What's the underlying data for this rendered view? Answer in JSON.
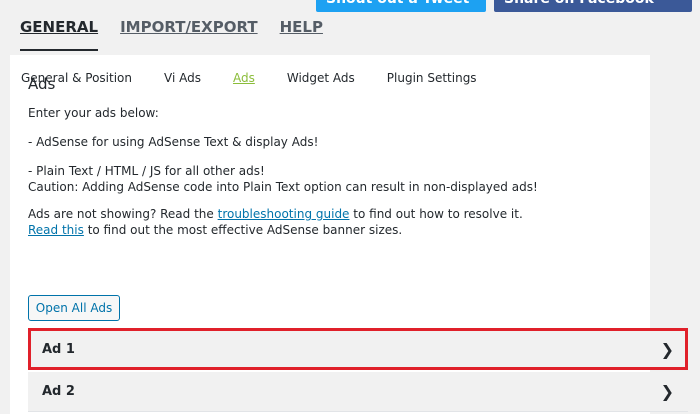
{
  "top_buttons": {
    "tweet": "Shout out a Tweet",
    "facebook": "Share on Facebook"
  },
  "main_tabs": [
    "GENERAL",
    "IMPORT/EXPORT",
    "HELP"
  ],
  "sub_tabs": [
    "General & Position",
    "Vi Ads",
    "Ads",
    "Widget Ads",
    "Plugin Settings"
  ],
  "ads": {
    "title": "Ads",
    "enter_text": "Enter your ads below:",
    "adsense_line": "- AdSense for using AdSense Text & display Ads!",
    "plain_line": "- Plain Text / HTML / JS for all other ads!",
    "caution_line": "Caution: Adding AdSense code into Plain Text option can result in non-displayed ads!",
    "not_showing_prefix": "Ads are not showing? Read the ",
    "troubleshooting_link": "troubleshooting guide",
    "not_showing_suffix": " to find out how to resolve it.",
    "read_this_link": "Read this",
    "read_this_suffix": " to find out the most effective AdSense banner sizes.",
    "open_all_label": "Open All Ads",
    "accordion_items": [
      "Ad 1",
      "Ad 2"
    ]
  }
}
